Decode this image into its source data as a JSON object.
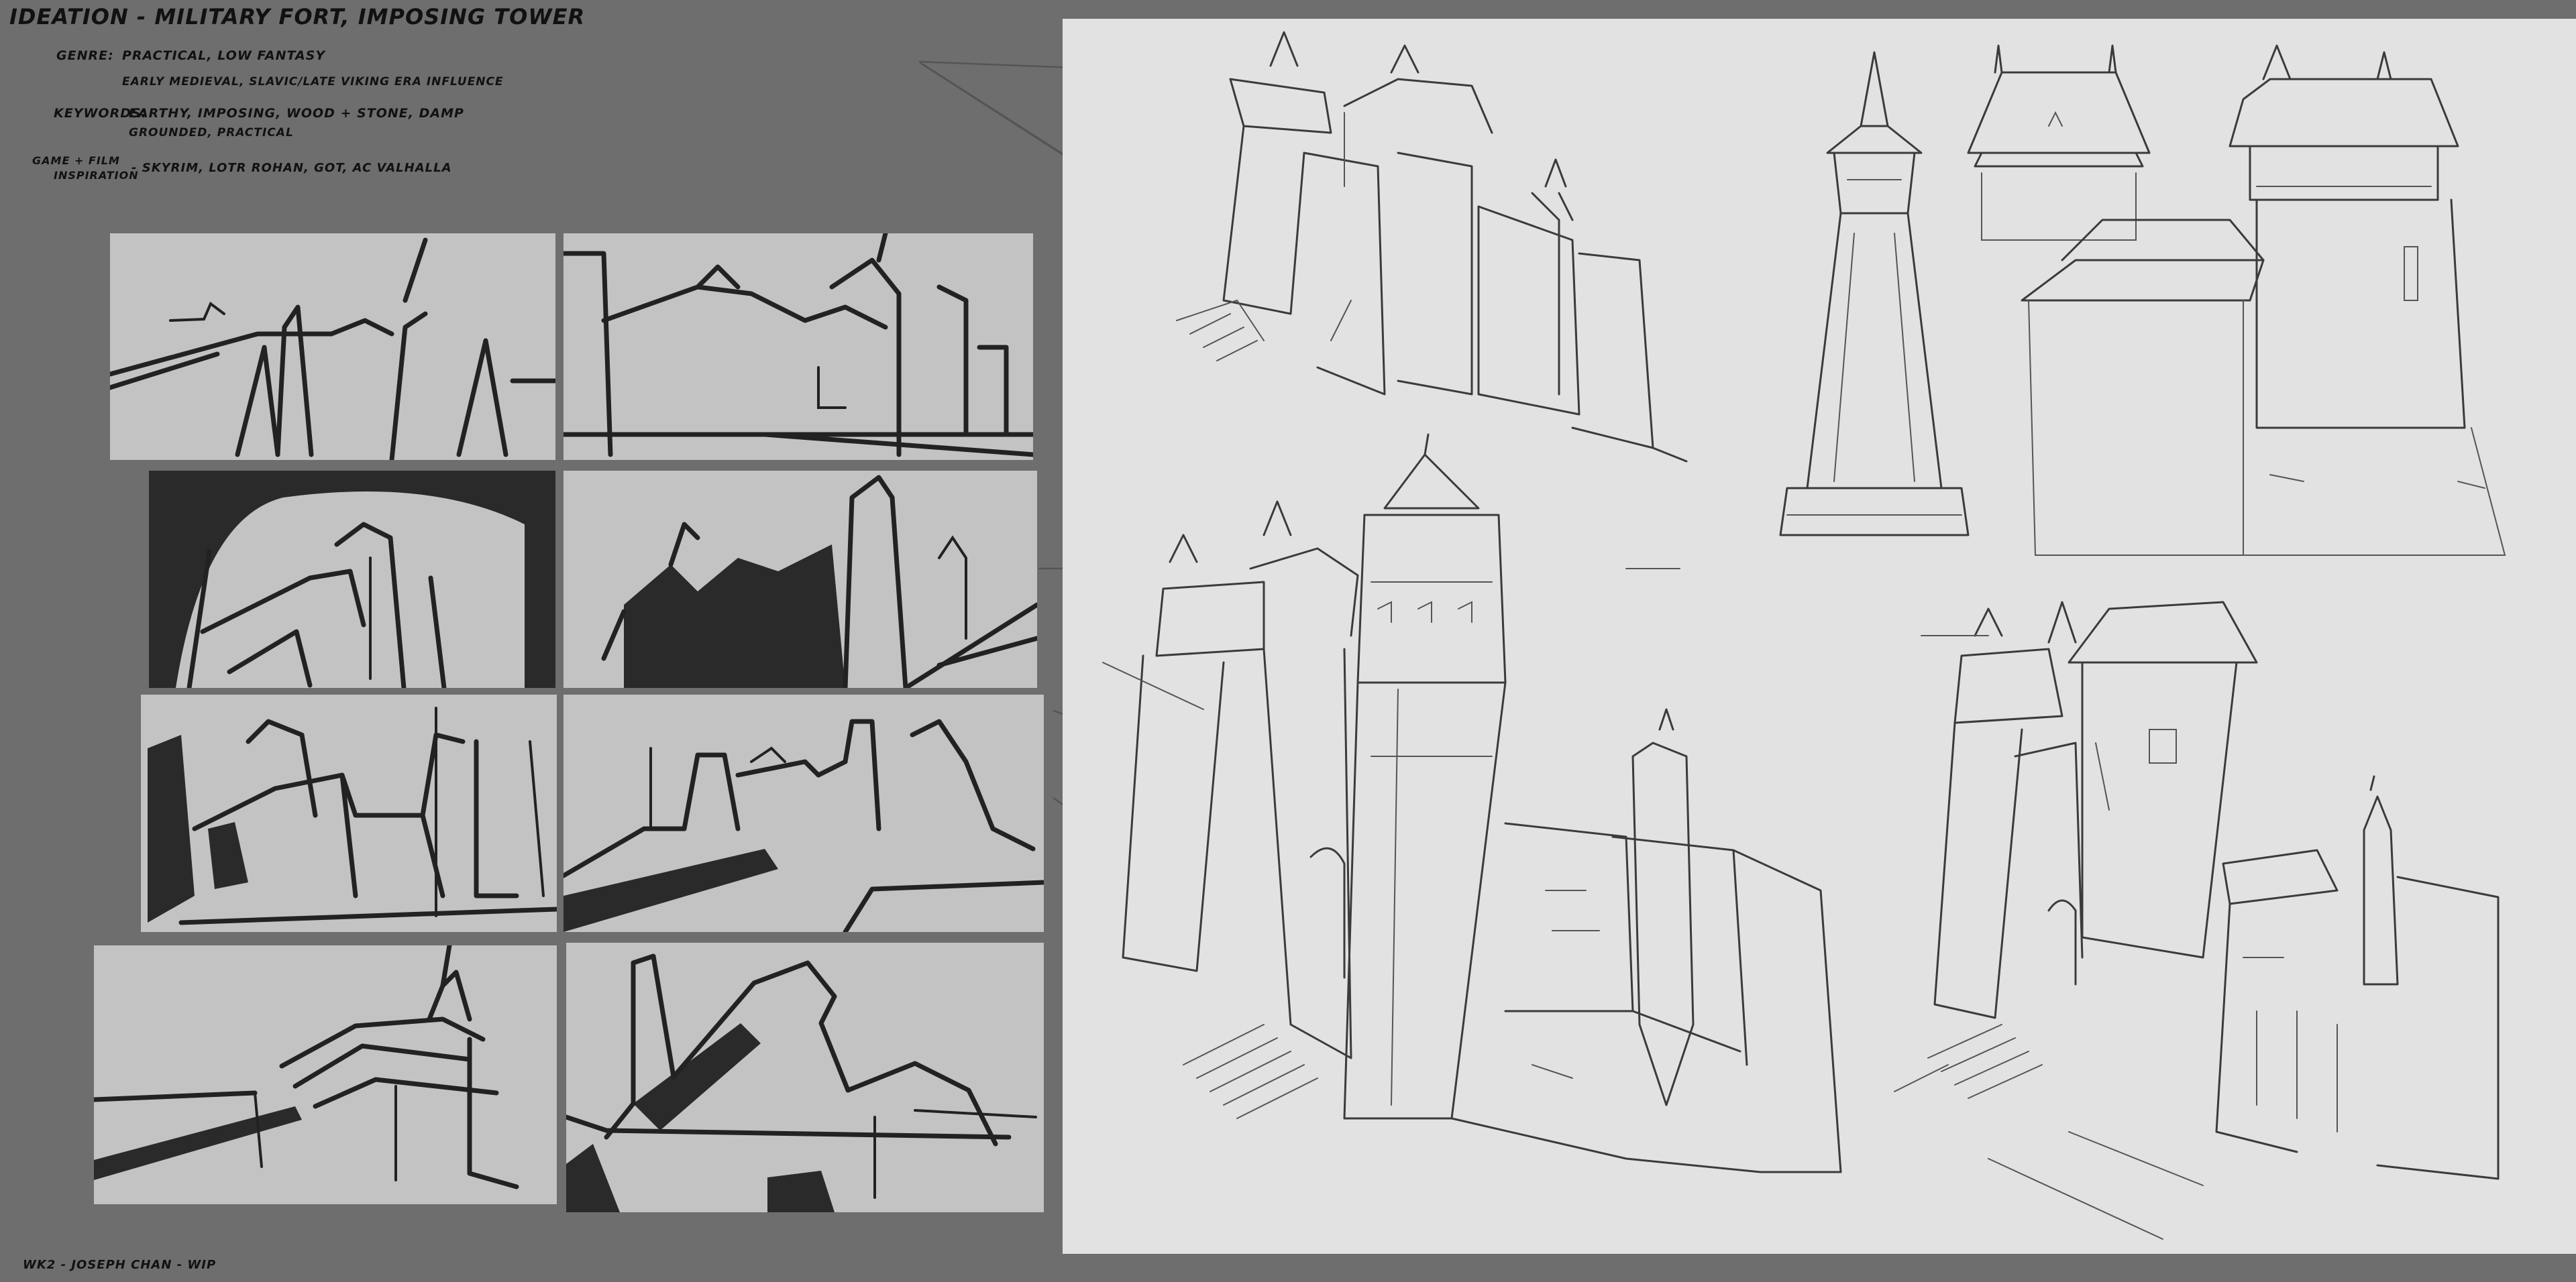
{
  "header": {
    "title": "Ideation - Military fort, imposing tower"
  },
  "brief": {
    "genre_label": "Genre:",
    "genre_line1": "Practical, low fantasy",
    "genre_line2": "Early medieval, slavic/late viking era influence",
    "keywords_label": "Keywords:",
    "keywords_line1": "Earthy, imposing, wood + stone, damp",
    "keywords_line2": "Grounded, practical",
    "inspiration_label1": "Game + Film",
    "inspiration_label2": "Inspiration",
    "inspiration_value": "- Skyrim, LotR Rohan, GoT, AC Valhalla"
  },
  "footer": {
    "credit": "WK2 - Joseph Chan - WIP"
  },
  "colors": {
    "background": "#6e6e6e",
    "thumbnail_panel": "#c3c3c3",
    "sketch_sheet": "#e2e2e2",
    "ink": "#222222"
  }
}
